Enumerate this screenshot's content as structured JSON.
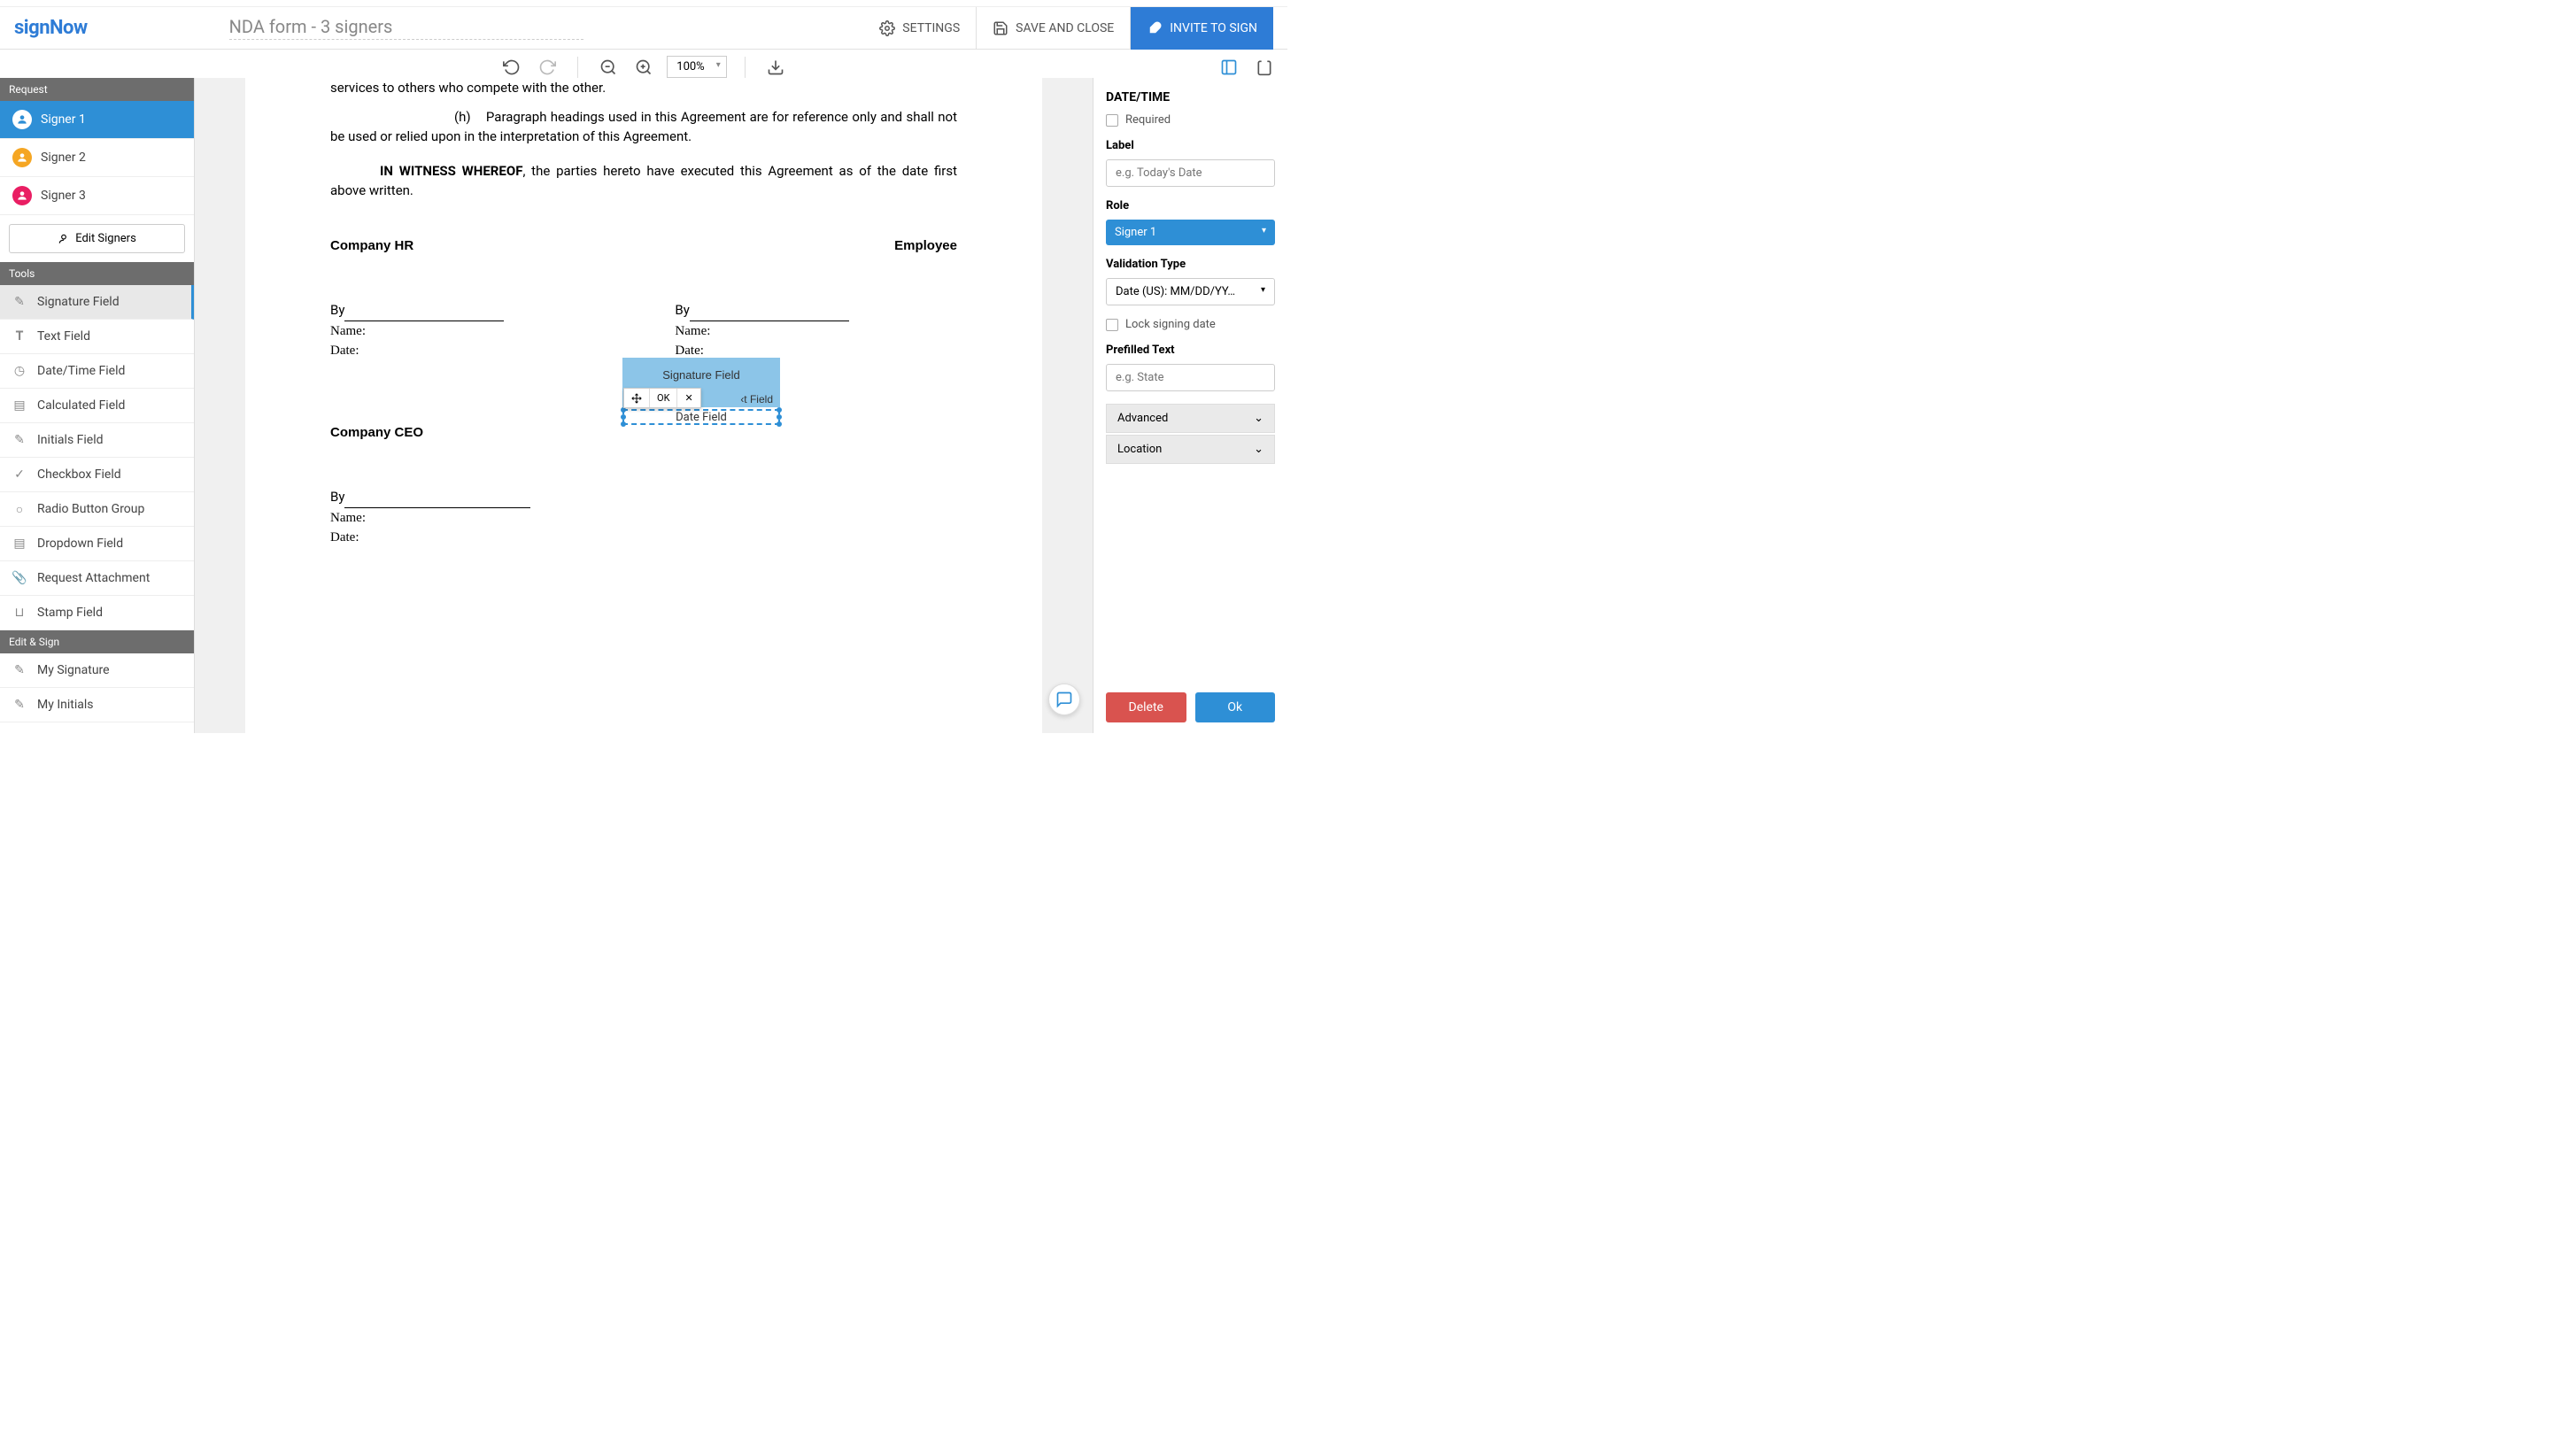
{
  "header": {
    "logo_sign": "sign",
    "logo_now": "Now",
    "doc_title": "NDA form - 3 signers",
    "settings": "SETTINGS",
    "save_close": "SAVE AND CLOSE",
    "invite": "INVITE TO SIGN"
  },
  "toolbar": {
    "zoom": "100%"
  },
  "left": {
    "request_header": "Request",
    "signers": [
      {
        "label": "Signer 1",
        "color": "blue",
        "active": true
      },
      {
        "label": "Signer 2",
        "color": "orange",
        "active": false
      },
      {
        "label": "Signer 3",
        "color": "pink",
        "active": false
      }
    ],
    "edit_signers": "Edit Signers",
    "tools_header": "Tools",
    "tools": [
      {
        "label": "Signature Field",
        "icon": "sig",
        "selected": true
      },
      {
        "label": "Text Field",
        "icon": "text",
        "selected": false
      },
      {
        "label": "Date/Time Field",
        "icon": "clock",
        "selected": false
      },
      {
        "label": "Calculated Field",
        "icon": "calc",
        "selected": false
      },
      {
        "label": "Initials Field",
        "icon": "initials",
        "selected": false
      },
      {
        "label": "Checkbox Field",
        "icon": "check",
        "selected": false
      },
      {
        "label": "Radio Button Group",
        "icon": "radio",
        "selected": false
      },
      {
        "label": "Dropdown Field",
        "icon": "dropdown",
        "selected": false
      },
      {
        "label": "Request Attachment",
        "icon": "attach",
        "selected": false
      },
      {
        "label": "Stamp Field",
        "icon": "stamp",
        "selected": false
      }
    ],
    "edit_sign_header": "Edit & Sign",
    "edit_sign": [
      {
        "label": "My Signature",
        "icon": "sig"
      },
      {
        "label": "My Initials",
        "icon": "initials"
      }
    ]
  },
  "doc": {
    "p1": "services to others who compete with the other.",
    "p2_h": "(h)",
    "p2": "Paragraph headings used in this Agreement are for reference only and shall not be used or relied upon in the interpretation of this Agreement.",
    "witness_bold": "IN WITNESS WHEREOF",
    "witness_rest": ", the parties hereto have executed this Agreement as of the date first above written.",
    "hr_title": "Company HR",
    "emp_title": "Employee",
    "ceo_title": "Company CEO",
    "by": "By",
    "name": "Name:",
    "date": "Date:",
    "field_sig": "Signature Field",
    "field_text": "‹t Field",
    "field_date": "Date Field",
    "ok": "OK"
  },
  "right": {
    "title": "DATE/TIME",
    "required": "Required",
    "label_label": "Label",
    "label_placeholder": "e.g. Today's Date",
    "role_label": "Role",
    "role_value": "Signer 1",
    "validation_label": "Validation Type",
    "validation_value": "Date (US): MM/DD/YY…",
    "lock_signing": "Lock signing date",
    "prefilled_label": "Prefilled Text",
    "prefilled_placeholder": "e.g. State",
    "advanced": "Advanced",
    "location": "Location",
    "delete": "Delete",
    "ok": "Ok"
  }
}
